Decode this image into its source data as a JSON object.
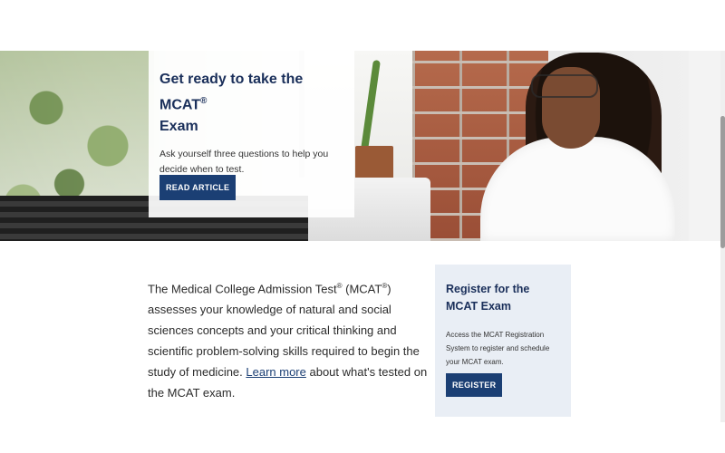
{
  "hero": {
    "title": "Get ready to take the MCAT",
    "title_mark": "®",
    "title_line2": "Exam",
    "description": "Ask yourself three questions to help you decide when to test.",
    "button_label": "READ ARTICLE"
  },
  "intro": {
    "part1": "The Medical College Admission Test",
    "mark1": "®",
    "part2": " (MCAT",
    "mark2": "®",
    "part3": ") assesses your knowledge of natural and social sciences concepts and your critical thinking and scientific problem-solving skills required to begin the study of medicine. ",
    "link_text": "Learn more",
    "part4": " about what's tested on the MCAT exam."
  },
  "register": {
    "title": "Register for the MCAT Exam",
    "description": "Access the MCAT Registration System to register and schedule your MCAT exam.",
    "button_label": "REGISTER"
  },
  "colors": {
    "navy": "#1b3f74",
    "title": "#1a2f5a",
    "card_bg": "#e9eef5"
  }
}
